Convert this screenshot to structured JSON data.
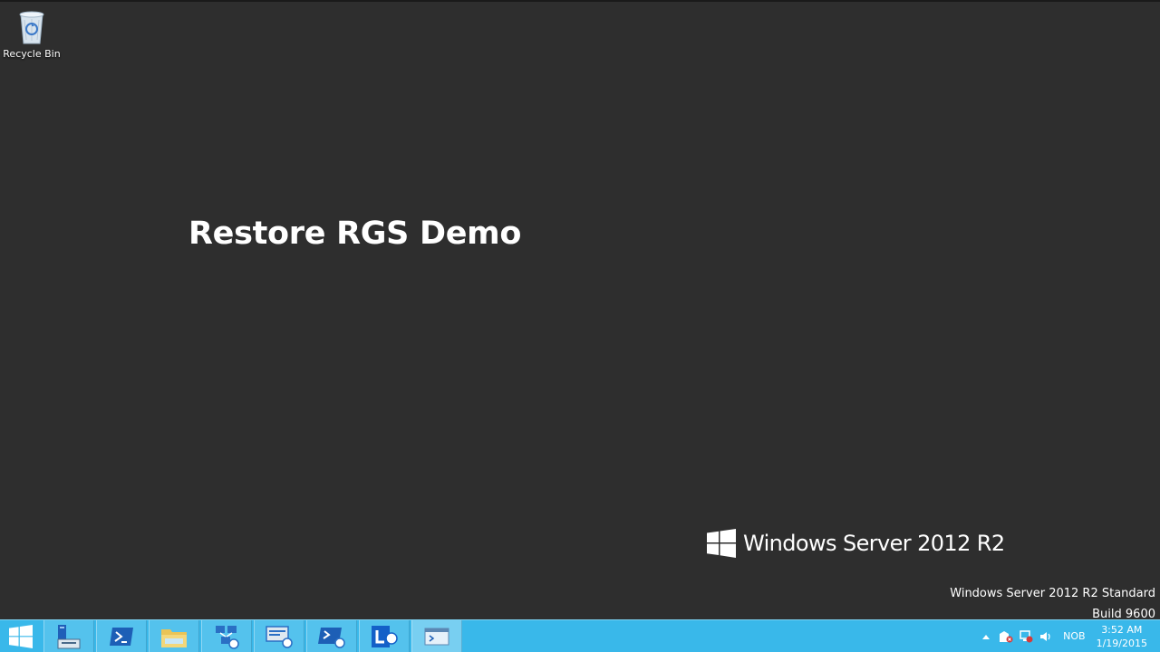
{
  "desktop": {
    "recycle_bin_label": "Recycle Bin",
    "title_text": "Restore RGS Demo",
    "brand_text": "Windows Server 2012 R2",
    "edition_line1": "Windows Server 2012 R2 Standard",
    "edition_line2": "Build 9600",
    "background_color": "#2e2e2e"
  },
  "taskbar": {
    "color": "#39b8ea",
    "buttons": [
      {
        "name": "start-button",
        "icon": "windows-logo-icon"
      },
      {
        "name": "server-manager",
        "icon": "server-manager-icon"
      },
      {
        "name": "powershell",
        "icon": "powershell-icon"
      },
      {
        "name": "file-explorer",
        "icon": "folder-icon"
      },
      {
        "name": "lync-topology-builder",
        "icon": "topology-icon"
      },
      {
        "name": "lync-deployment-wizard",
        "icon": "deployment-icon"
      },
      {
        "name": "lync-management-shell",
        "icon": "management-shell-icon"
      },
      {
        "name": "lync-control-panel",
        "icon": "lync-icon"
      },
      {
        "name": "powershell-active",
        "icon": "powershell-window-icon"
      }
    ],
    "tray": {
      "language": "NOB",
      "time": "3:52 AM",
      "date": "1/19/2015"
    }
  }
}
